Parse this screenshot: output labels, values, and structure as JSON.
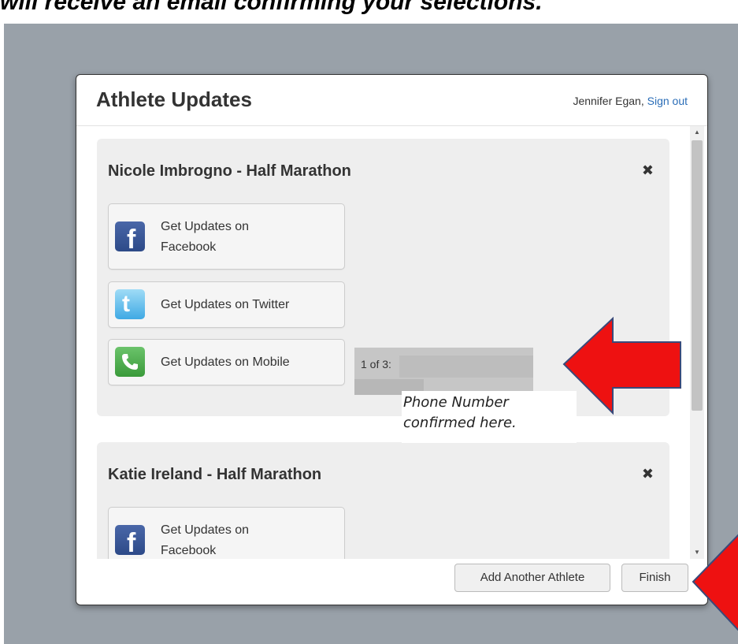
{
  "banner": {
    "text": "will receive an email confirming your selections."
  },
  "modal": {
    "title": "Athlete Updates",
    "user": {
      "name": "Jennifer Egan,",
      "sign_out": "Sign out"
    }
  },
  "athletes": [
    {
      "name": "Nicole Imbrogno - Half Marathon",
      "buttons": [
        {
          "icon": "facebook-icon",
          "label_line1": "Get Updates on",
          "label_line2": "Facebook"
        },
        {
          "icon": "twitter-icon",
          "label": "Get Updates on Twitter"
        },
        {
          "icon": "phone-icon",
          "label": "Get Updates on Mobile"
        }
      ],
      "mobile_confirmation": "1 of 3:"
    },
    {
      "name": "Katie Ireland - Half Marathon",
      "buttons": [
        {
          "icon": "facebook-icon",
          "label_line1": "Get Updates on",
          "label_line2": "Facebook"
        }
      ]
    }
  ],
  "annotation": {
    "line1": "Phone Number",
    "line2": "confirmed here."
  },
  "footer": {
    "add_label": "Add Another Athlete",
    "finish_label": "Finish"
  },
  "colors": {
    "arrow": "#ee1111",
    "overlay": "#99a1a9",
    "link": "#2a6db7"
  }
}
